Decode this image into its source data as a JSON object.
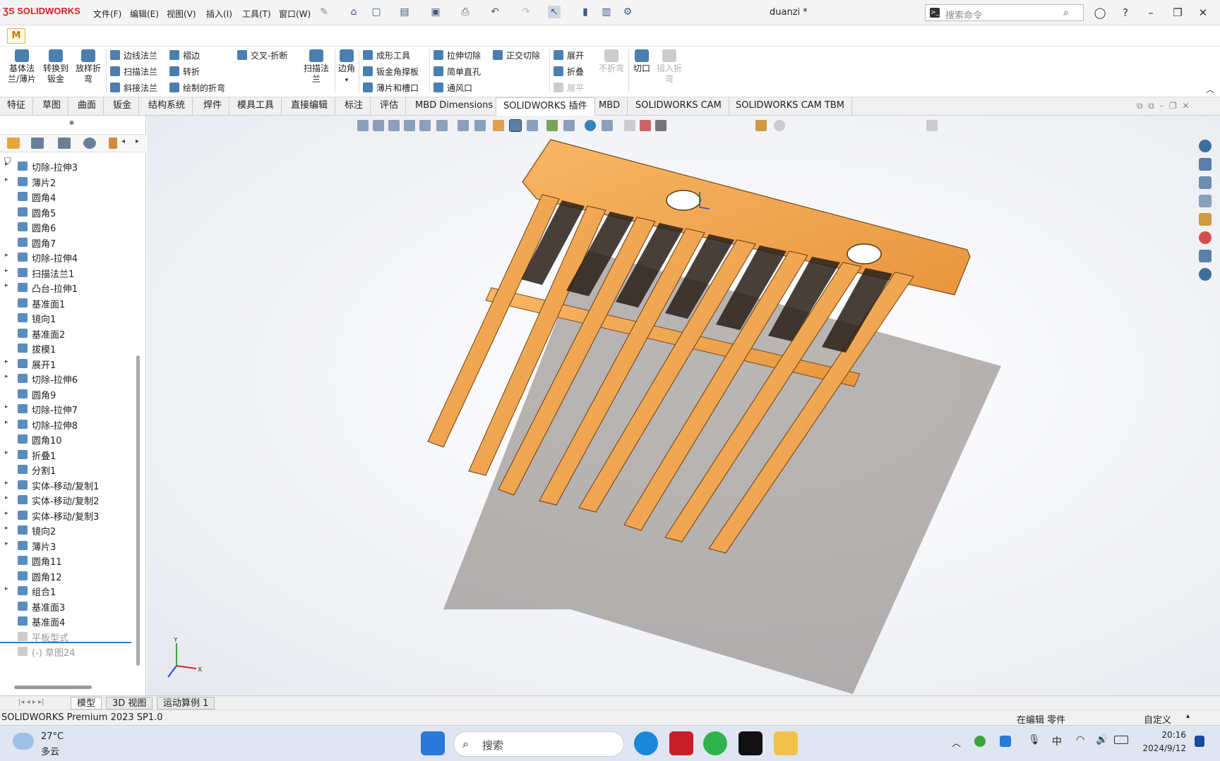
{
  "app": {
    "logo": "SOLIDWORKS",
    "title": "duanzi *"
  },
  "menu": [
    "文件(F)",
    "编辑(E)",
    "视图(V)",
    "插入(I)",
    "工具(T)",
    "窗口(W)"
  ],
  "search": {
    "placeholder": "搜索命令"
  },
  "doc_tab": "M",
  "ribbon": {
    "big": [
      {
        "label": "基体法\n兰/薄片"
      },
      {
        "label": "转换到\n钣金"
      },
      {
        "label": "放样折\n弯"
      },
      {
        "label": "扫描法\n兰"
      },
      {
        "label": "边角"
      },
      {
        "label": "切口"
      },
      {
        "label": "插入折\n弯"
      }
    ],
    "small": {
      "edge_flange": "边线法兰",
      "hem": "褶边",
      "cross_break": "交叉-折断",
      "swept_flange": "扫描法兰",
      "jog": "转折",
      "miter_flange": "斜接法兰",
      "sketched_bend": "绘制的折弯",
      "forming_tool": "成形工具",
      "gusset": "钣金角撑板",
      "tab_slot": "薄片和槽口",
      "extruded_cut": "拉伸切除",
      "normal_cut": "正交切除",
      "simple_hole": "简单直孔",
      "vent": "通风口",
      "unfold": "展开",
      "fold": "折叠",
      "flatten": "展平",
      "no_bends": "不折弯"
    }
  },
  "tabs": [
    "特征",
    "草图",
    "曲面",
    "钣金",
    "结构系统",
    "焊件",
    "模具工具",
    "直接编辑",
    "标注",
    "评估",
    "MBD Dimensions",
    "SOLIDWORKS 插件",
    "MBD",
    "SOLIDWORKS CAM",
    "SOLIDWORKS CAM TBM"
  ],
  "active_tab": "SOLIDWORKS 插件",
  "tree": [
    {
      "label": "切除-拉伸3",
      "expand": true
    },
    {
      "label": "薄片2",
      "expand": true
    },
    {
      "label": "圆角4",
      "expand": false
    },
    {
      "label": "圆角5",
      "expand": false
    },
    {
      "label": "圆角6",
      "expand": false
    },
    {
      "label": "圆角7",
      "expand": false
    },
    {
      "label": "切除-拉伸4",
      "expand": true
    },
    {
      "label": "扫描法兰1",
      "expand": true
    },
    {
      "label": "凸台-拉伸1",
      "expand": true
    },
    {
      "label": "基准面1",
      "expand": false
    },
    {
      "label": "镜向1",
      "expand": false
    },
    {
      "label": "基准面2",
      "expand": false
    },
    {
      "label": "拔模1",
      "expand": false
    },
    {
      "label": "展开1",
      "expand": true
    },
    {
      "label": "切除-拉伸6",
      "expand": true
    },
    {
      "label": "圆角9",
      "expand": false
    },
    {
      "label": "切除-拉伸7",
      "expand": true
    },
    {
      "label": "切除-拉伸8",
      "expand": true
    },
    {
      "label": "圆角10",
      "expand": false
    },
    {
      "label": "折叠1",
      "expand": true
    },
    {
      "label": "分割1",
      "expand": false
    },
    {
      "label": "实体-移动/复制1",
      "expand": true
    },
    {
      "label": "实体-移动/复制2",
      "expand": true
    },
    {
      "label": "实体-移动/复制3",
      "expand": true
    },
    {
      "label": "镜向2",
      "expand": true
    },
    {
      "label": "薄片3",
      "expand": true
    },
    {
      "label": "圆角11",
      "expand": false
    },
    {
      "label": "圆角12",
      "expand": false
    },
    {
      "label": "组合1",
      "expand": true
    },
    {
      "label": "基准面3",
      "expand": false
    },
    {
      "label": "基准面4",
      "expand": false
    },
    {
      "label": "平板型式",
      "expand": false,
      "grey": true
    },
    {
      "label": "(-) 草图24",
      "expand": false,
      "grey": true
    }
  ],
  "axes": {
    "x": "X",
    "y": "Y"
  },
  "bottom_tabs": [
    "模型",
    "3D 视图",
    "运动算例 1"
  ],
  "status": {
    "product": "SOLIDWORKS Premium 2023 SP1.0",
    "mode": "在编辑 零件",
    "units": "自定义"
  },
  "taskbar": {
    "weather_temp": "27°C",
    "weather_desc": "多云",
    "search": "搜索",
    "ime": "中",
    "time": "20:16",
    "date": "2024/9/12"
  },
  "colors": {
    "part": "#f2a650",
    "accent": "#d31f26"
  }
}
